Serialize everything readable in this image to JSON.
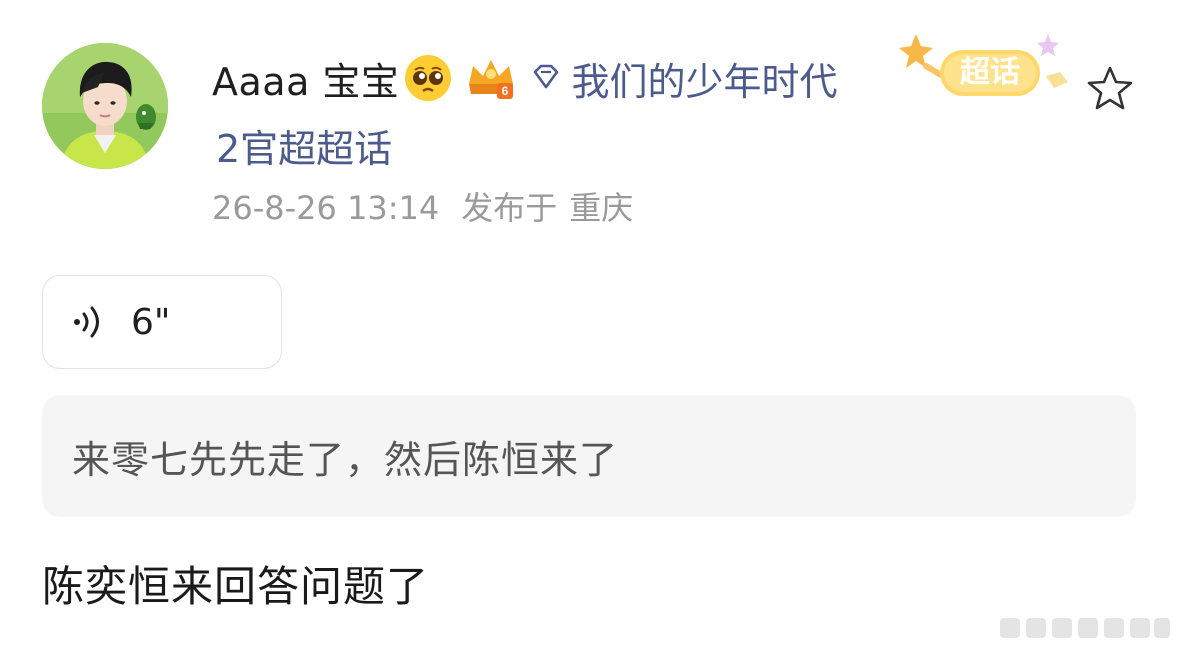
{
  "author": {
    "name": "Aaaa 宝宝",
    "emoji_icon": "pleading-face-emoji",
    "level_badge": "crown-badge-icon",
    "level_number": "6"
  },
  "topic": {
    "icon": "diamond-icon",
    "name_part1": "我们的少年时代",
    "name_part2": "2官超超话",
    "badge_label": "超话",
    "link_color": "#4c5b8c"
  },
  "meta": {
    "timestamp": "26-8-26 13:14",
    "location_prefix": "发布于",
    "location": "重庆"
  },
  "voice": {
    "icon": "voice-wave-icon",
    "duration": "6\""
  },
  "quote": {
    "text": "来零七先先走了，然后陈恒来了"
  },
  "body": {
    "text": "陈奕恒来回答问题了"
  },
  "actions": {
    "favorite_icon": "star-outline-icon"
  }
}
